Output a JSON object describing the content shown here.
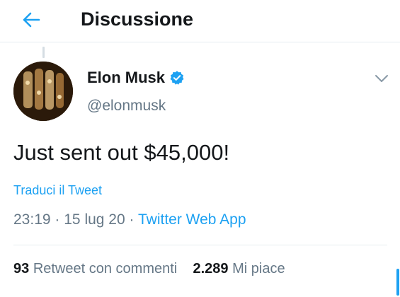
{
  "header": {
    "title": "Discussione",
    "back_icon": "arrow-left-icon",
    "accent_color": "#1da1f2"
  },
  "author": {
    "name": "Elon Musk",
    "handle": "@elonmusk",
    "verified_icon": "verified-badge-icon",
    "more_icon": "chevron-down-icon"
  },
  "tweet": {
    "text": "Just sent out $45,000!",
    "translate_label": "Traduci il Tweet",
    "time": "23:19",
    "separator": "·",
    "date": "15 lug 20",
    "source": "Twitter Web App"
  },
  "stats": {
    "retweets_count": "93",
    "retweets_label": "Retweet con commenti",
    "likes_count": "2.289",
    "likes_label": "Mi piace"
  },
  "colors": {
    "text": "#14171a",
    "secondary": "#657786",
    "link": "#1da1f2",
    "border": "#e6ecf0"
  }
}
